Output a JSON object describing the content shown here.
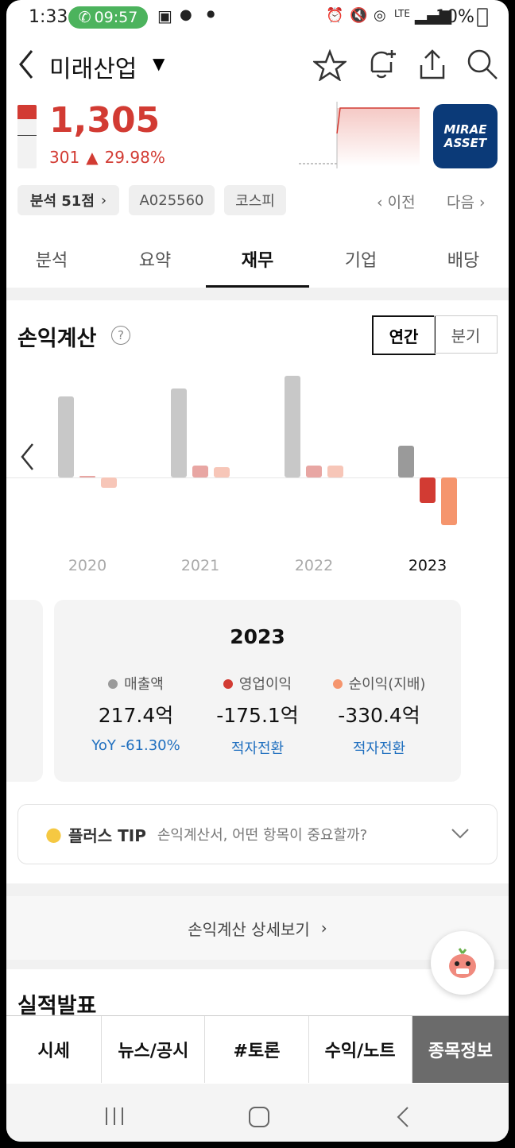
{
  "status": {
    "time": "1:33",
    "call_time": "09:57",
    "lte": "LTE",
    "battery": "10%"
  },
  "header": {
    "stock_name": "미래산업",
    "price": "1,305",
    "change": "301",
    "change_pct": "29.98%",
    "logo_line1": "MIRAE",
    "logo_line2": "ASSET"
  },
  "chips": {
    "analysis": "분석 51점",
    "code": "A025560",
    "market": "코스피",
    "prev": "이전",
    "next": "다음"
  },
  "tabs": [
    "분석",
    "요약",
    "재무",
    "기업",
    "배당"
  ],
  "section": {
    "title": "손익계산",
    "toggle_annual": "연간",
    "toggle_quarter": "분기"
  },
  "chart_data": {
    "type": "bar",
    "categories": [
      "2020",
      "2021",
      "2022",
      "2023"
    ],
    "series": [
      {
        "name": "매출액",
        "values": [
          560,
          610,
          700,
          217.4
        ]
      },
      {
        "name": "영업이익",
        "values": [
          5,
          80,
          80,
          -175.1
        ]
      },
      {
        "name": "순이익(지배)",
        "values": [
          -70,
          70,
          80,
          -330.4
        ]
      }
    ],
    "colors": [
      "#c8c8c8",
      "#e8a6a3",
      "#f7c6b8"
    ],
    "colors_highlight": [
      "#9a9a9a",
      "#d23b33",
      "#f5956d"
    ]
  },
  "summary_card": {
    "year": "2023",
    "items": [
      {
        "label": "매출액",
        "value": "217.4억",
        "sub": "YoY -61.30%",
        "dot": "#9a9a9a"
      },
      {
        "label": "영업이익",
        "value": "-175.1억",
        "sub": "적자전환",
        "dot": "#d23b33"
      },
      {
        "label": "순이익(지배)",
        "value": "-330.4억",
        "sub": "적자전환",
        "dot": "#f5956d"
      }
    ]
  },
  "tip": {
    "label": "플러스 TIP",
    "text": "손익계산서, 어떤 항목이 중요할까?"
  },
  "detail_link": "손익계산 상세보기",
  "next_section": "실적발표",
  "bottom_nav": [
    "시세",
    "뉴스/공시",
    "#토론",
    "수익/노트",
    "종목정보"
  ]
}
